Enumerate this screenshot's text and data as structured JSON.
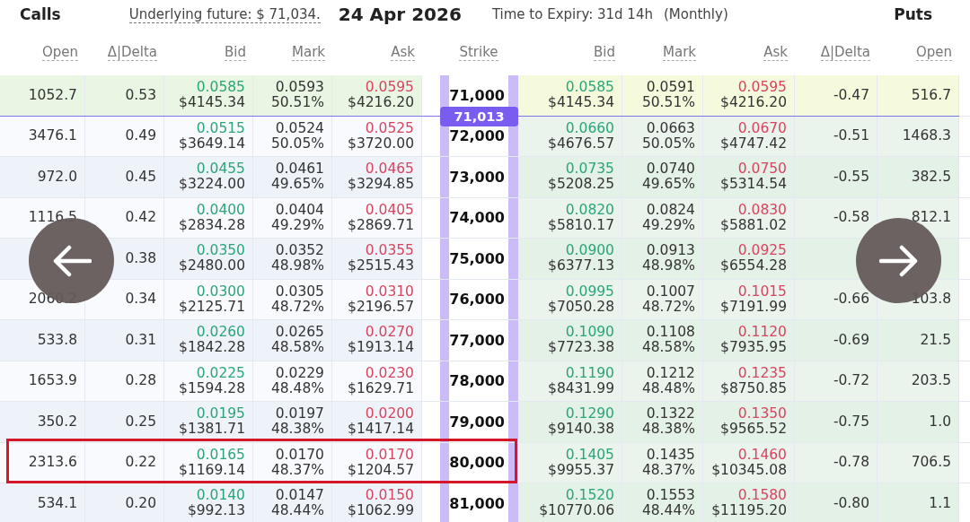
{
  "header": {
    "calls_label": "Calls",
    "underlying": "Underlying future: $ 71,034.",
    "date": "24 Apr 2026",
    "expiry": "Time to Expiry: 31d 14h",
    "cycle": "(Monthly)",
    "puts_label": "Puts"
  },
  "call_columns": [
    "Open",
    "Δ|Delta",
    "Bid",
    "Mark",
    "Ask"
  ],
  "strike_column": "Strike",
  "put_columns": [
    "Bid",
    "Mark",
    "Ask",
    "Δ|Delta",
    "Open"
  ],
  "rows": [
    {
      "strike": "71,000",
      "price_marker": "71,013",
      "selected": false,
      "call_itm": true,
      "put_itm": false,
      "call": {
        "open": "1052.7",
        "delta": "0.53",
        "bid": [
          "0.0585",
          "$4145.34"
        ],
        "mark": [
          "0.0593",
          "50.51%"
        ],
        "ask": [
          "0.0595",
          "$4216.20"
        ]
      },
      "put": {
        "bid": [
          "0.0585",
          "$4145.34"
        ],
        "mark": [
          "0.0591",
          "50.51%"
        ],
        "ask": [
          "0.0595",
          "$4216.20"
        ],
        "delta": "-0.47",
        "open": "516.7"
      }
    },
    {
      "strike": "72,000",
      "selected": false,
      "call_itm": false,
      "put_itm": true,
      "call": {
        "open": "3476.1",
        "delta": "0.49",
        "bid": [
          "0.0515",
          "$3649.14"
        ],
        "mark": [
          "0.0524",
          "50.05%"
        ],
        "ask": [
          "0.0525",
          "$3720.00"
        ]
      },
      "put": {
        "bid": [
          "0.0660",
          "$4676.57"
        ],
        "mark": [
          "0.0663",
          "50.05%"
        ],
        "ask": [
          "0.0670",
          "$4747.42"
        ],
        "delta": "-0.51",
        "open": "1468.3"
      }
    },
    {
      "strike": "73,000",
      "selected": false,
      "call_itm": false,
      "put_itm": true,
      "call": {
        "open": "972.0",
        "delta": "0.45",
        "bid": [
          "0.0455",
          "$3224.00"
        ],
        "mark": [
          "0.0461",
          "49.65%"
        ],
        "ask": [
          "0.0465",
          "$3294.85"
        ]
      },
      "put": {
        "bid": [
          "0.0735",
          "$5208.25"
        ],
        "mark": [
          "0.0740",
          "49.65%"
        ],
        "ask": [
          "0.0750",
          "$5314.54"
        ],
        "delta": "-0.55",
        "open": "382.5"
      }
    },
    {
      "strike": "74,000",
      "selected": false,
      "call_itm": false,
      "put_itm": true,
      "call": {
        "open": "1116.5",
        "delta": "0.42",
        "bid": [
          "0.0400",
          "$2834.28"
        ],
        "mark": [
          "0.0404",
          "49.29%"
        ],
        "ask": [
          "0.0405",
          "$2869.71"
        ]
      },
      "put": {
        "bid": [
          "0.0820",
          "$5810.17"
        ],
        "mark": [
          "0.0824",
          "49.29%"
        ],
        "ask": [
          "0.0830",
          "$5881.02"
        ],
        "delta": "-0.58",
        "open": "812.1"
      }
    },
    {
      "strike": "75,000",
      "selected": false,
      "call_itm": false,
      "put_itm": true,
      "call": {
        "delta": "0.38",
        "bid": [
          "0.0350",
          "$2480.00"
        ],
        "mark": [
          "0.0352",
          "48.98%"
        ],
        "ask": [
          "0.0355",
          "$2515.43"
        ]
      },
      "put": {
        "bid": [
          "0.0900",
          "$6377.13"
        ],
        "mark": [
          "0.0913",
          "48.98%"
        ],
        "ask": [
          "0.0925",
          "$6554.28"
        ]
      }
    },
    {
      "strike": "76,000",
      "selected": false,
      "call_itm": false,
      "put_itm": true,
      "call": {
        "open": "2060.2",
        "delta": "0.34",
        "bid": [
          "0.0300",
          "$2125.71"
        ],
        "mark": [
          "0.0305",
          "48.72%"
        ],
        "ask": [
          "0.0310",
          "$2196.57"
        ]
      },
      "put": {
        "bid": [
          "0.0995",
          "$7050.28"
        ],
        "mark": [
          "0.1007",
          "48.72%"
        ],
        "ask": [
          "0.1015",
          "$7191.99"
        ],
        "delta": "-0.66",
        "open": "103.8"
      }
    },
    {
      "strike": "77,000",
      "selected": false,
      "call_itm": false,
      "put_itm": true,
      "call": {
        "open": "533.8",
        "delta": "0.31",
        "bid": [
          "0.0260",
          "$1842.28"
        ],
        "mark": [
          "0.0265",
          "48.58%"
        ],
        "ask": [
          "0.0270",
          "$1913.14"
        ]
      },
      "put": {
        "bid": [
          "0.1090",
          "$7723.38"
        ],
        "mark": [
          "0.1108",
          "48.58%"
        ],
        "ask": [
          "0.1120",
          "$7935.95"
        ],
        "delta": "-0.69",
        "open": "21.5"
      }
    },
    {
      "strike": "78,000",
      "selected": false,
      "call_itm": false,
      "put_itm": true,
      "call": {
        "open": "1653.9",
        "delta": "0.28",
        "bid": [
          "0.0225",
          "$1594.28"
        ],
        "mark": [
          "0.0229",
          "48.48%"
        ],
        "ask": [
          "0.0230",
          "$1629.71"
        ]
      },
      "put": {
        "bid": [
          "0.1190",
          "$8431.99"
        ],
        "mark": [
          "0.1212",
          "48.48%"
        ],
        "ask": [
          "0.1235",
          "$8750.85"
        ],
        "delta": "-0.72",
        "open": "203.5"
      }
    },
    {
      "strike": "79,000",
      "selected": false,
      "call_itm": false,
      "put_itm": true,
      "call": {
        "open": "350.2",
        "delta": "0.25",
        "bid": [
          "0.0195",
          "$1381.71"
        ],
        "mark": [
          "0.0197",
          "48.38%"
        ],
        "ask": [
          "0.0200",
          "$1417.14"
        ]
      },
      "put": {
        "bid": [
          "0.1290",
          "$9140.38"
        ],
        "mark": [
          "0.1322",
          "48.38%"
        ],
        "ask": [
          "0.1350",
          "$9565.52"
        ],
        "delta": "-0.75",
        "open": "1.0"
      }
    },
    {
      "strike": "80,000",
      "selected": true,
      "call_itm": false,
      "put_itm": true,
      "call": {
        "open": "2313.6",
        "delta": "0.22",
        "bid": [
          "0.0165",
          "$1169.14"
        ],
        "mark": [
          "0.0170",
          "48.37%"
        ],
        "ask": [
          "0.0170",
          "$1204.57"
        ]
      },
      "put": {
        "bid": [
          "0.1405",
          "$9955.37"
        ],
        "mark": [
          "0.1435",
          "48.37%"
        ],
        "ask": [
          "0.1460",
          "$10345.08"
        ],
        "delta": "-0.78",
        "open": "706.5"
      }
    },
    {
      "strike": "81,000",
      "selected": false,
      "call_itm": false,
      "put_itm": true,
      "call": {
        "open": "534.1",
        "delta": "0.20",
        "bid": [
          "0.0140",
          "$992.13"
        ],
        "mark": [
          "0.0147",
          "48.44%"
        ],
        "ask": [
          "0.0150",
          "$1062.99"
        ]
      },
      "put": {
        "bid": [
          "0.1520",
          "$10770.06"
        ],
        "mark": [
          "0.1553",
          "48.44%"
        ],
        "ask": [
          "0.1580",
          "$11195.20"
        ],
        "delta": "-0.80",
        "open": "1.1"
      }
    }
  ]
}
